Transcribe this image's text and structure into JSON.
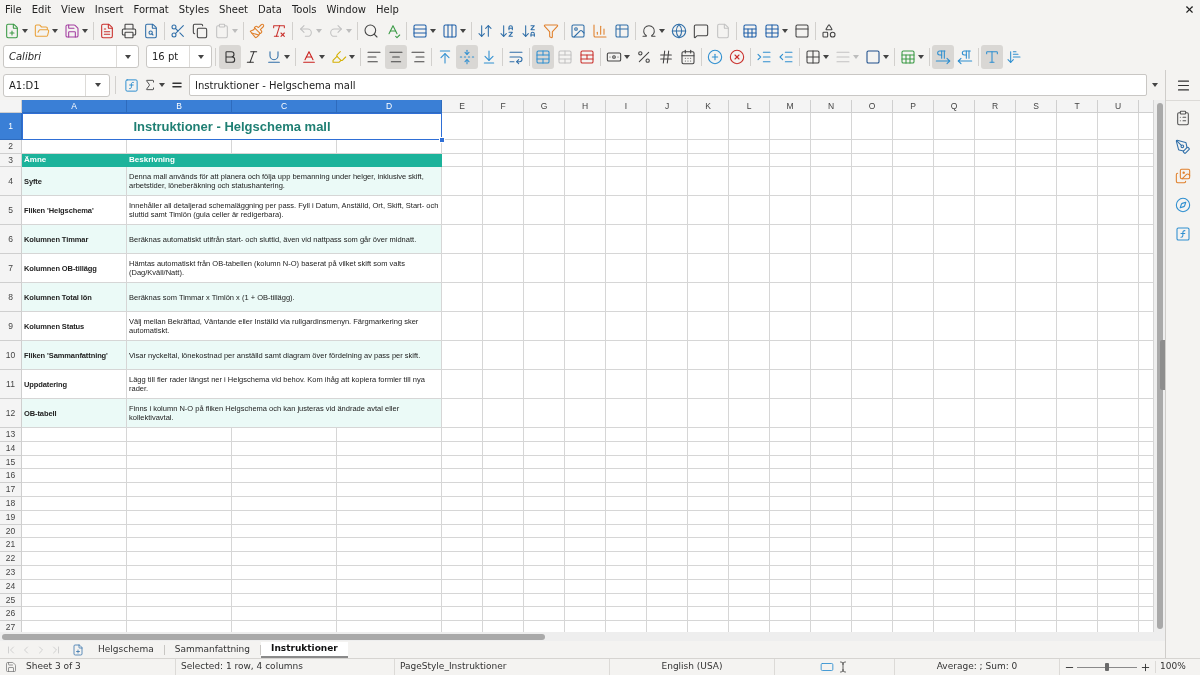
{
  "menu_bar": {
    "items": [
      "File",
      "Edit",
      "View",
      "Insert",
      "Format",
      "Styles",
      "Sheet",
      "Data",
      "Tools",
      "Window",
      "Help"
    ]
  },
  "standard_toolbar": {
    "groups": [
      [
        {
          "kind": "new",
          "menu": true,
          "disabled": false
        },
        {
          "kind": "open",
          "menu": true,
          "disabled": false
        },
        {
          "kind": "save",
          "menu": true,
          "disabled": false
        }
      ],
      [
        {
          "kind": "export_pdf",
          "menu": false,
          "disabled": false
        },
        {
          "kind": "print",
          "menu": false,
          "disabled": false
        },
        {
          "kind": "print_preview",
          "menu": false,
          "disabled": false
        }
      ],
      [
        {
          "kind": "cut",
          "menu": false,
          "disabled": false
        },
        {
          "kind": "copy",
          "menu": false,
          "disabled": false
        },
        {
          "kind": "paste",
          "menu": true,
          "disabled": true
        }
      ],
      [
        {
          "kind": "clone_formatting",
          "menu": false,
          "disabled": false
        },
        {
          "kind": "clear_formatting",
          "menu": false,
          "disabled": false
        }
      ],
      [
        {
          "kind": "undo",
          "menu": true,
          "disabled": true
        },
        {
          "kind": "redo",
          "menu": true,
          "disabled": true
        }
      ],
      [
        {
          "kind": "find_replace",
          "menu": false,
          "disabled": false
        },
        {
          "kind": "spelling",
          "menu": false,
          "disabled": false
        }
      ],
      [
        {
          "kind": "row",
          "menu": true,
          "disabled": false
        },
        {
          "kind": "column",
          "menu": true,
          "disabled": false
        }
      ],
      [
        {
          "kind": "sort",
          "menu": false,
          "disabled": false
        },
        {
          "kind": "sort_ascending",
          "menu": false,
          "disabled": false
        },
        {
          "kind": "sort_descending",
          "menu": false,
          "disabled": false
        },
        {
          "kind": "autofilter",
          "menu": false,
          "disabled": false
        }
      ],
      [
        {
          "kind": "image",
          "menu": false,
          "disabled": false
        },
        {
          "kind": "chart",
          "menu": false,
          "disabled": false
        },
        {
          "kind": "pivot_table",
          "menu": false,
          "disabled": false
        }
      ],
      [
        {
          "kind": "special_character",
          "menu": true,
          "disabled": false
        },
        {
          "kind": "hyperlink",
          "menu": false,
          "disabled": false
        },
        {
          "kind": "comment",
          "menu": false,
          "disabled": false
        },
        {
          "kind": "headers_footers",
          "menu": false,
          "disabled": true
        }
      ],
      [
        {
          "kind": "define_print_area",
          "menu": false,
          "disabled": false
        },
        {
          "kind": "freeze",
          "menu": true,
          "disabled": false
        },
        {
          "kind": "split_window",
          "menu": false,
          "disabled": false
        }
      ],
      [
        {
          "kind": "shapes",
          "menu": false,
          "disabled": false
        }
      ]
    ]
  },
  "formatting_toolbar": {
    "font_name": "Calibri",
    "font_size": "16 pt",
    "groups": [
      [
        {
          "kind": "bold",
          "on": true,
          "menu": false,
          "disabled": false
        },
        {
          "kind": "italic",
          "on": false,
          "menu": false,
          "disabled": false
        },
        {
          "kind": "underline",
          "on": false,
          "menu": true,
          "disabled": false
        }
      ],
      [
        {
          "kind": "font_color",
          "on": false,
          "menu": true,
          "disabled": false
        },
        {
          "kind": "highlight",
          "on": false,
          "menu": true,
          "disabled": false
        }
      ],
      [
        {
          "kind": "align_left",
          "on": false,
          "menu": false,
          "disabled": false
        },
        {
          "kind": "align_center",
          "on": true,
          "menu": false,
          "disabled": false
        },
        {
          "kind": "align_right",
          "on": false,
          "menu": false,
          "disabled": false
        }
      ],
      [
        {
          "kind": "align_top",
          "on": false,
          "menu": false,
          "disabled": false
        },
        {
          "kind": "align_middle",
          "on": true,
          "menu": false,
          "disabled": false
        },
        {
          "kind": "align_bottom",
          "on": false,
          "menu": false,
          "disabled": false
        }
      ],
      [
        {
          "kind": "wrap_text",
          "on": false,
          "menu": false,
          "disabled": false
        }
      ],
      [
        {
          "kind": "merge_center",
          "on": true,
          "menu": false,
          "disabled": false
        },
        {
          "kind": "merge",
          "on": false,
          "menu": false,
          "disabled": true
        },
        {
          "kind": "unmerge",
          "on": false,
          "menu": false,
          "disabled": false
        }
      ],
      [
        {
          "kind": "currency",
          "on": false,
          "menu": true,
          "disabled": false
        },
        {
          "kind": "percent",
          "on": false,
          "menu": false,
          "disabled": false
        },
        {
          "kind": "number",
          "on": false,
          "menu": false,
          "disabled": false
        },
        {
          "kind": "date",
          "on": false,
          "menu": false,
          "disabled": false
        }
      ],
      [
        {
          "kind": "add_decimal",
          "on": false,
          "menu": false,
          "disabled": false
        },
        {
          "kind": "delete_decimal",
          "on": false,
          "menu": false,
          "disabled": false
        }
      ],
      [
        {
          "kind": "increase_indent",
          "on": false,
          "menu": false,
          "disabled": false
        },
        {
          "kind": "decrease_indent",
          "on": false,
          "menu": false,
          "disabled": false
        }
      ],
      [
        {
          "kind": "borders",
          "on": false,
          "menu": true,
          "disabled": false
        },
        {
          "kind": "border_style",
          "on": false,
          "menu": true,
          "disabled": true
        },
        {
          "kind": "border_color",
          "on": false,
          "menu": true,
          "disabled": false
        }
      ],
      [
        {
          "kind": "conditional",
          "on": false,
          "menu": true,
          "disabled": false
        }
      ],
      [
        {
          "kind": "left_to_right",
          "on": true,
          "menu": false,
          "disabled": false
        },
        {
          "kind": "right_to_left",
          "on": false,
          "menu": false,
          "disabled": false
        }
      ],
      [
        {
          "kind": "text_horizontal",
          "on": true,
          "menu": false,
          "disabled": false
        },
        {
          "kind": "text_vertical",
          "on": false,
          "menu": false,
          "disabled": false
        }
      ]
    ]
  },
  "formula_bar": {
    "name_box": "A1:D1",
    "formula": "Instruktioner - Helgschema mall"
  },
  "sheet": {
    "columns": [
      {
        "label": "A",
        "selected": true
      },
      {
        "label": "B",
        "selected": true
      },
      {
        "label": "C",
        "selected": true
      },
      {
        "label": "D",
        "selected": true
      },
      {
        "label": "E",
        "selected": false
      },
      {
        "label": "F",
        "selected": false
      },
      {
        "label": "G",
        "selected": false
      },
      {
        "label": "H",
        "selected": false
      },
      {
        "label": "I",
        "selected": false
      },
      {
        "label": "J",
        "selected": false
      },
      {
        "label": "K",
        "selected": false
      },
      {
        "label": "L",
        "selected": false
      },
      {
        "label": "M",
        "selected": false
      },
      {
        "label": "N",
        "selected": false
      },
      {
        "label": "O",
        "selected": false
      },
      {
        "label": "P",
        "selected": false
      },
      {
        "label": "Q",
        "selected": false
      },
      {
        "label": "R",
        "selected": false
      },
      {
        "label": "S",
        "selected": false
      },
      {
        "label": "T",
        "selected": false
      },
      {
        "label": "U",
        "selected": false
      }
    ],
    "rows": [
      {
        "label": "1",
        "selected": true
      },
      {
        "label": "2",
        "selected": false
      },
      {
        "label": "3",
        "selected": false
      },
      {
        "label": "4",
        "selected": false
      },
      {
        "label": "5",
        "selected": false
      },
      {
        "label": "6",
        "selected": false
      },
      {
        "label": "7",
        "selected": false
      },
      {
        "label": "8",
        "selected": false
      },
      {
        "label": "9",
        "selected": false
      },
      {
        "label": "10",
        "selected": false
      },
      {
        "label": "11",
        "selected": false
      },
      {
        "label": "12",
        "selected": false
      },
      {
        "label": "13",
        "selected": false
      },
      {
        "label": "14",
        "selected": false
      },
      {
        "label": "15",
        "selected": false
      },
      {
        "label": "16",
        "selected": false
      },
      {
        "label": "17",
        "selected": false
      },
      {
        "label": "18",
        "selected": false
      },
      {
        "label": "19",
        "selected": false
      },
      {
        "label": "20",
        "selected": false
      },
      {
        "label": "21",
        "selected": false
      },
      {
        "label": "22",
        "selected": false
      },
      {
        "label": "23",
        "selected": false
      },
      {
        "label": "24",
        "selected": false
      },
      {
        "label": "25",
        "selected": false
      },
      {
        "label": "26",
        "selected": false
      },
      {
        "label": "27",
        "selected": false
      }
    ],
    "title": "Instruktioner - Helgschema mall",
    "header": {
      "topic": "Ämne",
      "description": "Beskrivning"
    },
    "entries": [
      {
        "topic": "Syfte",
        "description": "Denna mall används för att planera och följa upp bemanning under helger, inklusive skift, arbetstider, löneberäkning och statushantering."
      },
      {
        "topic": "Fliken 'Helgschema'",
        "description": "Innehåller all detaljerad schemaläggning per pass. Fyll i Datum, Anställd, Ort, Skift, Start- och sluttid samt Timlön (gula celler är redigerbara)."
      },
      {
        "topic": "Kolumnen Timmar",
        "description": "Beräknas automatiskt utifrån start- och sluttid, även vid nattpass som går över midnatt."
      },
      {
        "topic": "Kolumnen OB-tillägg",
        "description": "Hämtas automatiskt från OB-tabellen (kolumn N-O) baserat på vilket skift som valts (Dag/Kväll/Natt)."
      },
      {
        "topic": "Kolumnen Total lön",
        "description": "Beräknas som Timmar x Timlön x (1 + OB-tillägg)."
      },
      {
        "topic": "Kolumnen Status",
        "description": "Välj mellan Bekräftad, Väntande eller Inställd via rullgardinsmenyn. Färgmarkering sker automatiskt."
      },
      {
        "topic": "Fliken 'Sammanfattning'",
        "description": "Visar nyckeltal, lönekostnad per anställd samt diagram över fördelning av pass per skift."
      },
      {
        "topic": "Uppdatering",
        "description": "Lägg till fler rader längst ner i Helgschema vid behov. Kom ihåg att kopiera formler till nya rader."
      },
      {
        "topic": "OB-tabell",
        "description": "Finns i kolumn N-O på fliken Helgschema och kan justeras vid ändrade avtal eller kollektivavtal."
      }
    ]
  },
  "sheet_tabs": {
    "navigation_disabled": true,
    "tabs": [
      {
        "label": "Helgschema",
        "selected": false
      },
      {
        "label": "Sammanfattning",
        "selected": false
      },
      {
        "label": "Instruktioner",
        "selected": true
      }
    ]
  },
  "status_bar": {
    "sheet_position": "Sheet 3 of 3",
    "selection": "Selected: 1 row, 4 columns",
    "page_style": "PageStyle_Instruktioner",
    "language": "English (USA)",
    "summary": "Average: ; Sum: 0",
    "zoom": {
      "level": 0.5,
      "reading": "100%"
    }
  }
}
